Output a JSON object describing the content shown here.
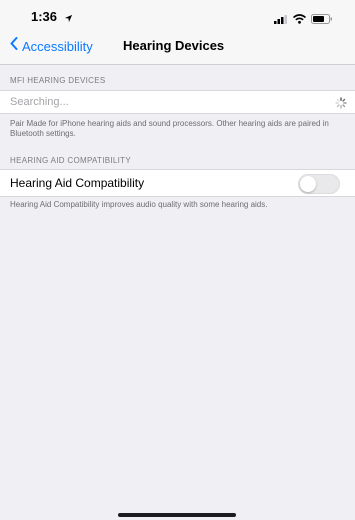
{
  "status_bar": {
    "time": "1:36"
  },
  "nav": {
    "back_label": "Accessibility",
    "title": "Hearing Devices"
  },
  "mfi_section": {
    "header": "MFI HEARING DEVICES",
    "searching_label": "Searching...",
    "footer": "Pair Made for iPhone hearing aids and sound processors. Other hearing aids are paired in Bluetooth settings."
  },
  "hac_section": {
    "header": "HEARING AID COMPATIBILITY",
    "row_label": "Hearing Aid Compatibility",
    "toggle_on": false,
    "footer": "Hearing Aid Compatibility improves audio quality with some hearing aids."
  },
  "colors": {
    "accent": "#0a7aff",
    "background": "#efeff4"
  }
}
